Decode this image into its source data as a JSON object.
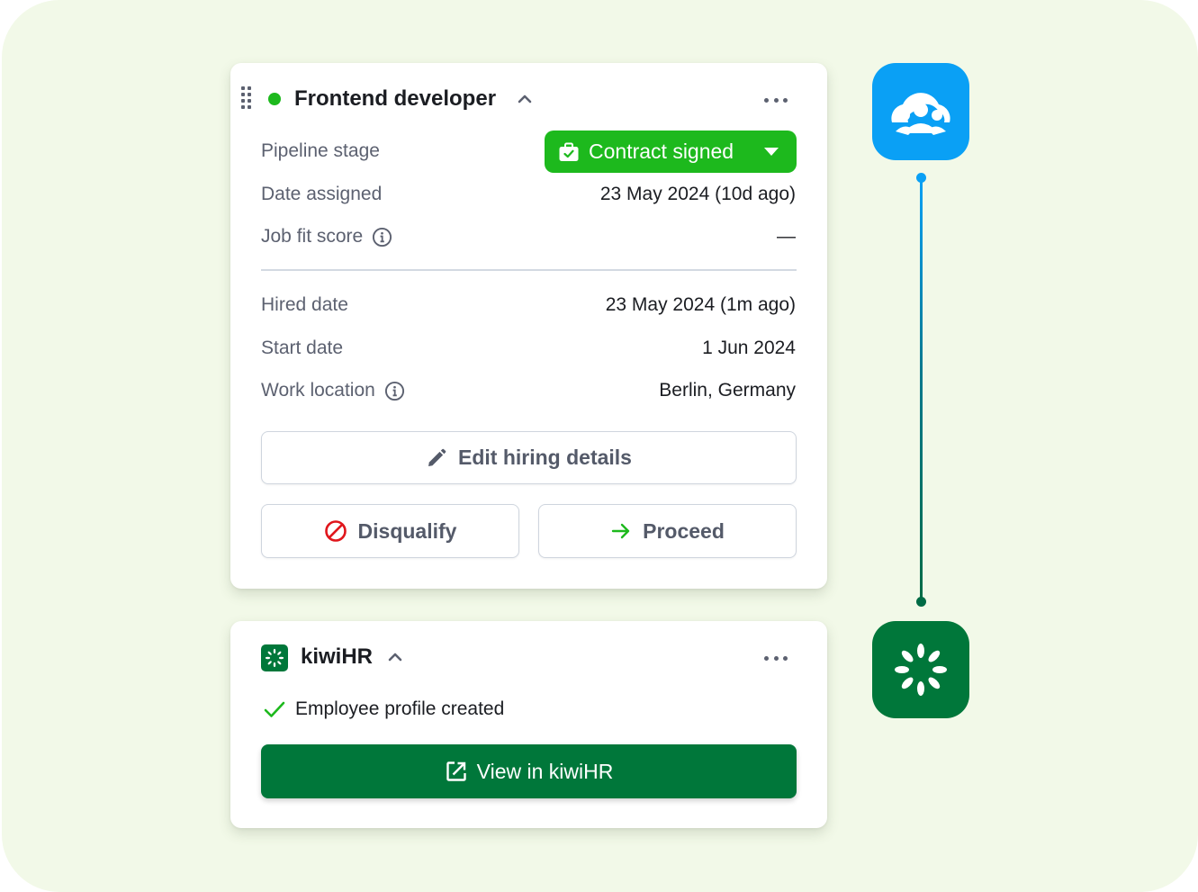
{
  "colors": {
    "background": "#f2f9e8",
    "status_active": "#1db91d",
    "stage_pill": "#1db91d",
    "kiwi_green": "#00773a",
    "recruitee_blue": "#0aa0f5",
    "disqualify_red": "#e0161c",
    "proceed_green": "#1db91d"
  },
  "ats_card": {
    "title": "Frontend developer",
    "status": "active",
    "icons": {
      "drag": "drag-handle-icon",
      "collapse": "chevron-up-icon",
      "menu": "more-horizontal-icon"
    },
    "pipeline_stage": {
      "label": "Pipeline stage",
      "value": "Contract signed",
      "icon": "briefcase-check-icon"
    },
    "date_assigned": {
      "label": "Date assigned",
      "value": "23 May 2024 (10d ago)"
    },
    "job_fit_score": {
      "label": "Job fit score",
      "value": "—",
      "icon": "info-icon"
    },
    "hired_date": {
      "label": "Hired date",
      "value": "23 May 2024 (1m ago)"
    },
    "start_date": {
      "label": "Start date",
      "value": "1 Jun 2024"
    },
    "work_location": {
      "label": "Work location",
      "value": "Berlin, Germany",
      "icon": "info-icon"
    },
    "buttons": {
      "edit": {
        "label": "Edit hiring details",
        "icon": "pencil-icon"
      },
      "disqualify": {
        "label": "Disqualify",
        "icon": "prohibited-icon"
      },
      "proceed": {
        "label": "Proceed",
        "icon": "arrow-right-icon"
      }
    }
  },
  "kiwi_card": {
    "title": "kiwiHR",
    "logo": "kiwihr-logo-icon",
    "status_text": "Employee profile created",
    "status_icon": "checkmark-icon",
    "button": {
      "label": "View in kiwiHR",
      "icon": "external-link-icon"
    }
  },
  "integration": {
    "source_app": "Recruitee",
    "source_icon": "recruitee-logo-icon",
    "target_app": "kiwiHR",
    "target_icon": "kiwihr-logo-icon"
  }
}
